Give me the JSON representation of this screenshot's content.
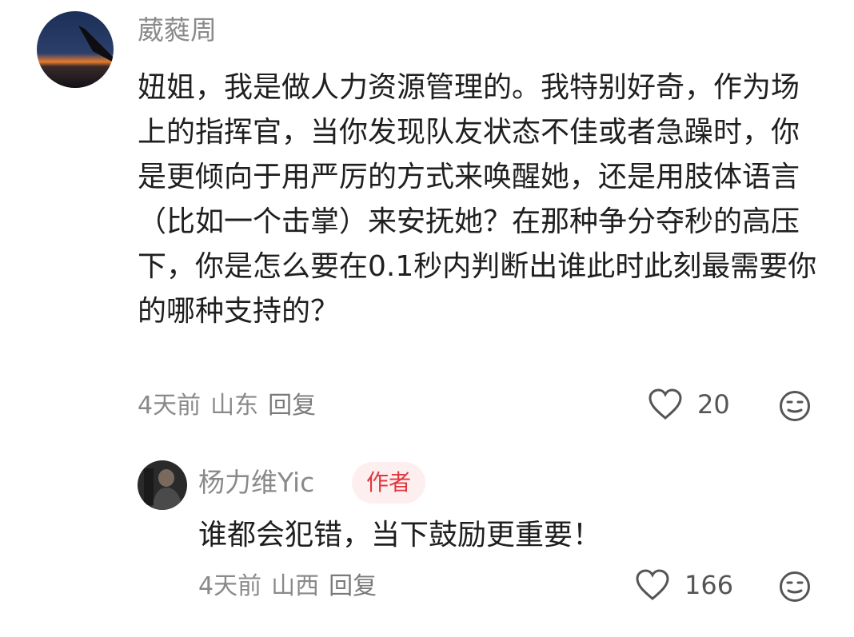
{
  "comment": {
    "username": "葳蕤周",
    "text": "妞姐，我是做人力资源管理的。我特别好奇，作为场上的指挥官，当你发现队友状态不佳或者急躁时，你是更倾向于用严厉的方式来唤醒她，还是用肢体语言（比如一个击掌）来安抚她？在那种争分夺秒的高压下，你是怎么要在0.1秒内判断出谁此时此刻最需要你的哪种支持的？",
    "time": "4天前",
    "location": "山东",
    "reply_label": "回复",
    "likes": "20",
    "avatar_icon": "airplane-wing-sunset-avatar"
  },
  "reply": {
    "username": "杨力维Yic",
    "badge": "作者",
    "text": "谁都会犯错，当下鼓励更重要！",
    "time": "4天前",
    "location": "山西",
    "reply_label": "回复",
    "likes": "166",
    "avatar_icon": "person-photo-avatar"
  },
  "colors": {
    "badge_bg": "#fdeff0",
    "badge_text": "#e0373f",
    "meta_text": "#8a8a8a"
  },
  "icons": {
    "like": "heart-outline-icon",
    "emoji": "neutral-face-icon"
  }
}
